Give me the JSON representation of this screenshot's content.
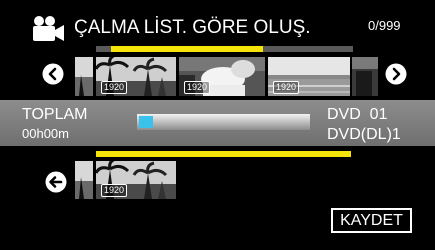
{
  "header": {
    "icon": "video-camera-icon",
    "title": "ÇALMA LİST. GÖRE OLUŞ.",
    "counter": "0/999"
  },
  "strip": {
    "prev_icon": "left-arrow-circle-icon",
    "next_icon": "right-arrow-circle-icon",
    "thumbnails": [
      {
        "badge": "1920"
      },
      {
        "badge": "1920"
      },
      {
        "badge": "1920"
      }
    ]
  },
  "summary": {
    "total_label": "TOPLAM",
    "total_time": "00h00m",
    "dvd_count": "DVD  01",
    "dvd_dl_count": "DVD(DL)1"
  },
  "selected": {
    "back_icon": "back-arrow-circle-icon",
    "thumbnails": [
      {
        "badge": "1920"
      }
    ]
  },
  "save_label": "KAYDET",
  "colors": {
    "accent_yellow": "#f4e40a",
    "capacity_blue": "#39c3ec",
    "bar_gray": "#7d7d7d"
  }
}
